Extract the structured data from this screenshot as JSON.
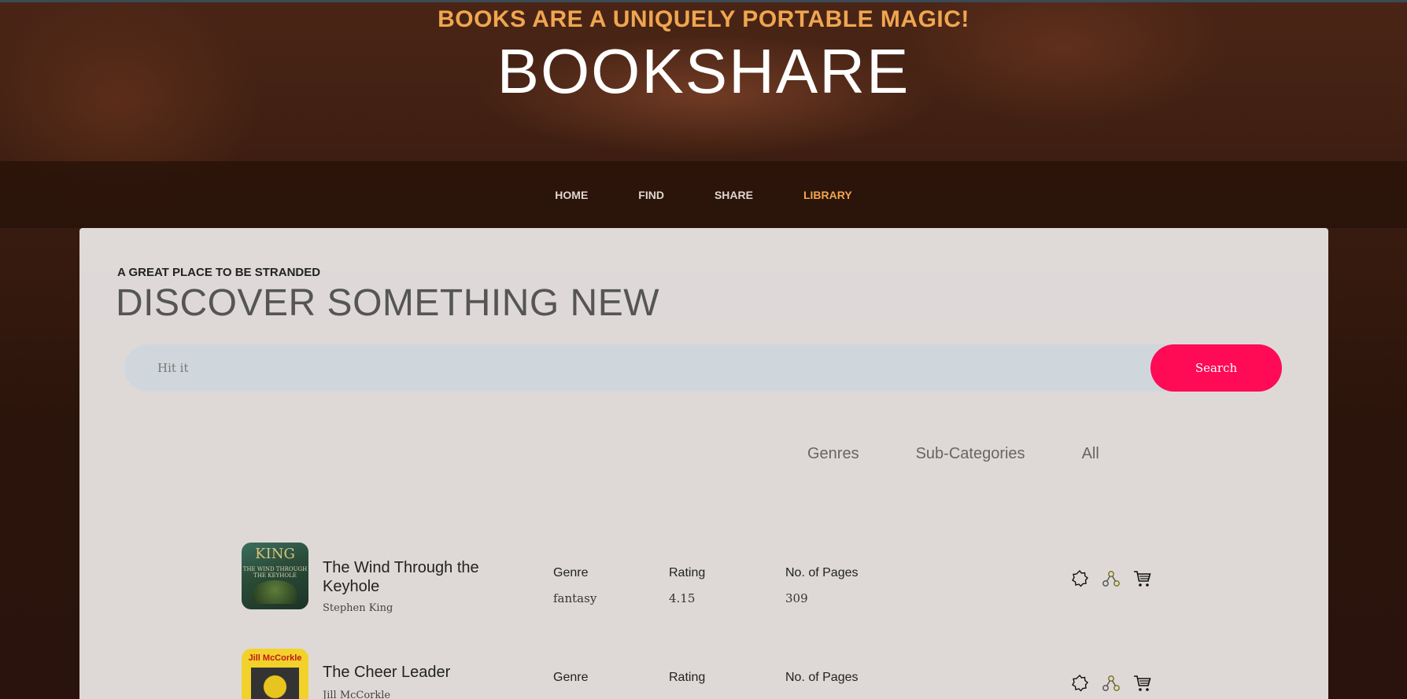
{
  "header": {
    "tagline": "BOOKS ARE A UNIQUELY PORTABLE MAGIC!",
    "brand": "BOOKSHARE"
  },
  "nav": {
    "items": [
      {
        "label": "HOME",
        "active": false
      },
      {
        "label": "FIND",
        "active": false
      },
      {
        "label": "SHARE",
        "active": false
      },
      {
        "label": "LIBRARY",
        "active": true
      }
    ]
  },
  "main": {
    "kicker": "A GREAT PLACE TO BE STRANDED",
    "headline": "DISCOVER SOMETHING NEW",
    "search": {
      "placeholder": "Hit it",
      "button_label": "Search"
    },
    "filters": [
      "Genres",
      "Sub-Categories",
      "All"
    ],
    "books": [
      {
        "title": "The Wind Through the Keyhole",
        "author": "Stephen King",
        "cover_text": "KING",
        "cover_subtext": "THE WIND THROUGH THE KEYHOLE",
        "genre_label": "Genre",
        "genre": "fantasy",
        "rating_label": "Rating",
        "rating": "4.15",
        "pages_label": "No. of Pages",
        "pages": "309",
        "actions": [
          "badge-icon",
          "share-icon",
          "cart-icon"
        ]
      },
      {
        "title": "The Cheer Leader",
        "author": "Jill McCorkle",
        "cover_text": "Jill McCorkle",
        "genre_label": "Genre",
        "rating_label": "Rating",
        "pages_label": "No. of Pages",
        "actions": [
          "badge-icon",
          "share-icon",
          "cart-icon"
        ]
      }
    ]
  },
  "colors": {
    "accent_orange": "#f0a64f",
    "search_button": "#ff0a55",
    "search_bar": "#d0d7dc"
  }
}
